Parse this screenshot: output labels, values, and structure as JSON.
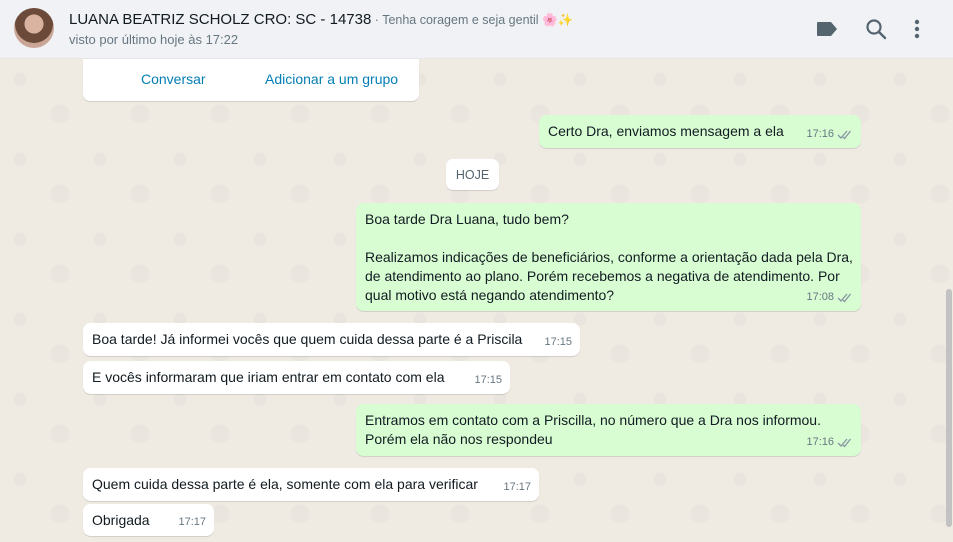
{
  "header": {
    "contact_name": "LUANA BEATRIZ SCHOLZ CRO: SC - 14738",
    "contact_status": " · Tenha coragem e seja gentil 🌸✨",
    "last_seen": "visto por último hoje às 17:22",
    "icons": [
      "label-icon",
      "search-icon",
      "menu-icon"
    ]
  },
  "contact_card": {
    "chat_button": "Conversar",
    "add_group_button": "Adicionar a um grupo"
  },
  "date_separator": "HOJE",
  "messages": [
    {
      "direction": "out",
      "text": "Certo Dra, enviamos mensagem a ela",
      "time": "17:16",
      "status": "read"
    },
    {
      "direction": "out",
      "text": "Boa tarde Dra Luana, tudo bem?\n\nRealizamos indicações de beneficiários, conforme a orientação dada pela Dra,\nde atendimento ao plano. Porém recebemos a negativa de atendimento. Por\nqual motivo está negando atendimento?",
      "time": "17:08",
      "status": "read"
    },
    {
      "direction": "in",
      "text": "Boa tarde! Já informei vocês que quem cuida dessa parte é a Priscila",
      "time": "17:15"
    },
    {
      "direction": "in",
      "text": "E vocês informaram que iriam entrar em contato com ela",
      "time": "17:15"
    },
    {
      "direction": "out",
      "text": "Entramos em contato com a Priscilla, no número que a Dra nos informou.\nPorém ela não nos respondeu",
      "time": "17:16",
      "status": "read"
    },
    {
      "direction": "in",
      "text": "Quem cuida dessa parte é ela, somente com ela para verificar",
      "time": "17:17"
    },
    {
      "direction": "in",
      "text": "Obrigada",
      "time": "17:17"
    }
  ],
  "colors": {
    "outgoing_bubble": "#d9fdd3",
    "incoming_bubble": "#ffffff",
    "read_ticks": "#8696a0",
    "link": "#027eb5"
  }
}
